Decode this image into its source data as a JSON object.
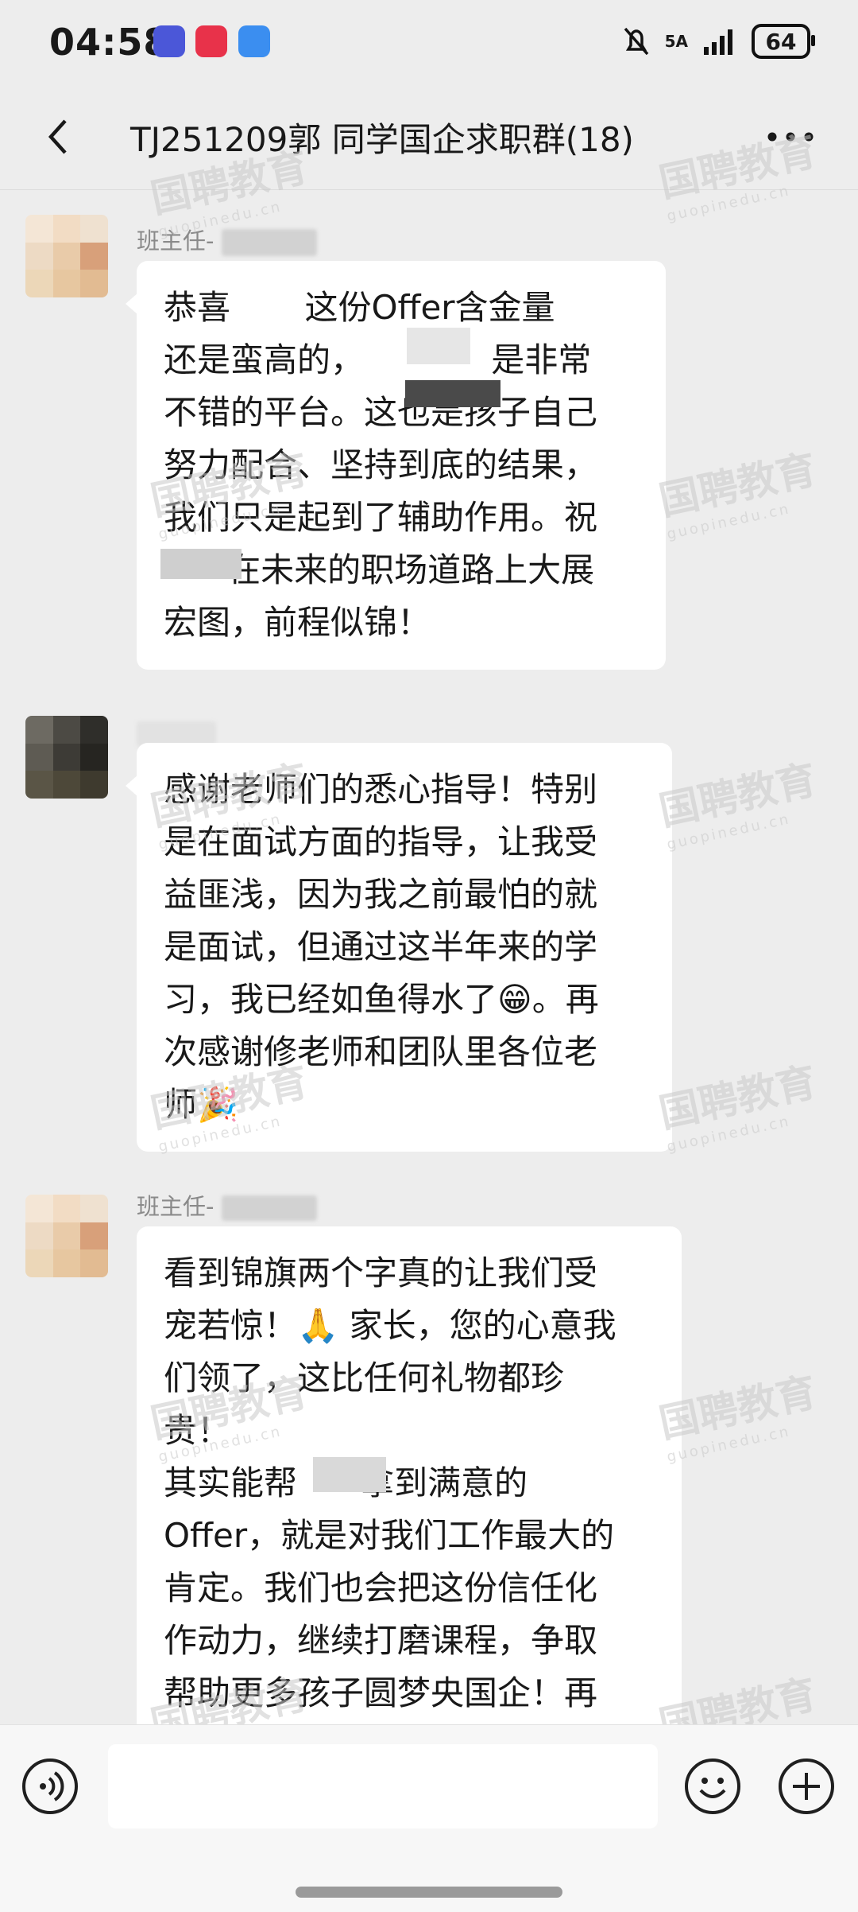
{
  "status_bar": {
    "time": "04:58",
    "network": "5A",
    "battery": "64",
    "app_icons": [
      "sticker-app-icon",
      "app-gallery-icon",
      "weather-icon"
    ]
  },
  "nav": {
    "title": "TJ251209郭      同学国企求职群(18)"
  },
  "messages": [
    {
      "sender": "班主任-",
      "lines": [
        "恭喜       这份Offer含金量",
        "还是蛮高的，            是非常",
        "不错的平台。这也是孩子自己",
        "努力配合、坚持到底的结果，",
        "我们只是起到了辅助作用。祝",
        "      在未来的职场道路上大展",
        "宏图，前程似锦！"
      ]
    },
    {
      "sender": "",
      "lines": [
        "感谢老师们的悉心指导！特别",
        "是在面试方面的指导，让我受",
        "益匪浅，因为我之前最怕的就",
        "是面试，但通过这半年来的学",
        "习，我已经如鱼得水了😁。再",
        "次感谢修老师和团队里各位老",
        "师🎉"
      ]
    },
    {
      "sender": "班主任-",
      "lines": [
        "看到锦旗两个字真的让我们受",
        "宠若惊！🙏 家长，您的心意我",
        "们领了，这比任何礼物都珍",
        "贵！",
        "其实能帮      拿到满意的",
        "Offer，就是对我们工作最大的",
        "肯定。我们也会把这份信任化",
        "作动力，继续打磨课程，争取",
        "帮助更多孩子圆梦央国企！再"
      ]
    }
  ],
  "watermark": {
    "brand": "国聘教育",
    "domain": "guopinedu.cn"
  },
  "icons": {
    "back": "back-chevron-icon",
    "more": "more-dots-icon",
    "voice": "voice-icon",
    "emoji": "emoji-icon",
    "plus": "plus-icon"
  },
  "colors": {
    "background": "#ededed",
    "bubble": "#ffffff",
    "text": "#191919",
    "sender": "#8a8a8a"
  }
}
